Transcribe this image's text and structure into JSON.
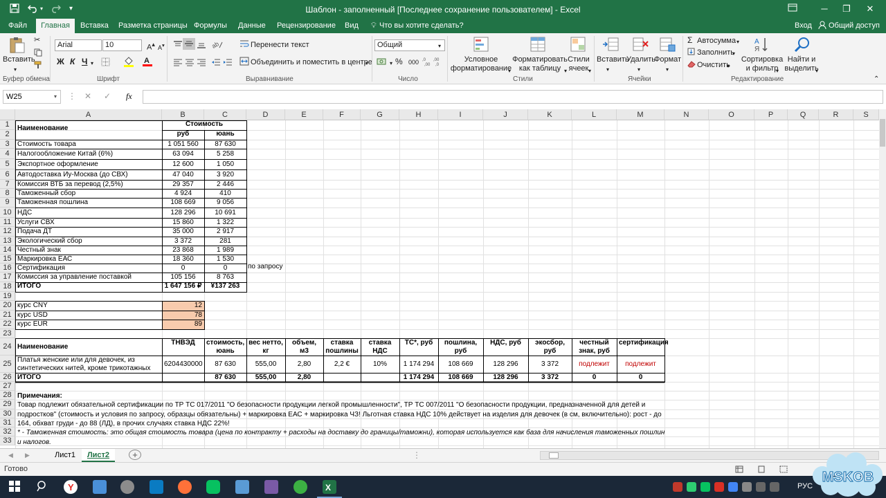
{
  "titlebar": {
    "title": "Шаблон - заполненный [Последнее сохранение пользователем] - Excel",
    "save_icon": "save-icon",
    "undo_icon": "undo-icon",
    "redo_icon": "redo-icon"
  },
  "tabs": {
    "file": "Файл",
    "home": "Главная",
    "insert": "Вставка",
    "layout": "Разметка страницы",
    "formulas": "Формулы",
    "data": "Данные",
    "review": "Рецензирование",
    "view": "Вид",
    "tell_me": "Что вы хотите сделать?",
    "signin": "Вход",
    "share": "Общий доступ"
  },
  "ribbon": {
    "clipboard": {
      "paste": "Вставить",
      "label": "Буфер обмена"
    },
    "font": {
      "name": "Arial",
      "size": "10",
      "bold": "Ж",
      "italic": "К",
      "underline": "Ч",
      "label": "Шрифт"
    },
    "alignment": {
      "wrap": "Перенести текст",
      "merge": "Объединить и поместить в центре",
      "label": "Выравнивание"
    },
    "number": {
      "format": "Общий",
      "percent": "%",
      "thousands": "000",
      "label": "Число"
    },
    "styles": {
      "conditional_1": "Условное",
      "conditional_2": "форматирование",
      "table_1": "Форматировать",
      "table_2": "как таблицу",
      "cell_1": "Стили",
      "cell_2": "ячеек",
      "label": "Стили"
    },
    "cells": {
      "insert": "Вставить",
      "delete": "Удалить",
      "format": "Формат",
      "label": "Ячейки"
    },
    "editing": {
      "autosum": "Автосумма",
      "fill": "Заполнить",
      "clear": "Очистить",
      "sort_1": "Сортировка",
      "sort_2": "и фильтр",
      "find_1": "Найти и",
      "find_2": "выделить",
      "label": "Редактирование"
    }
  },
  "formula_bar": {
    "name_box": "W25",
    "cancel": "✕",
    "enter": "✓",
    "fx": "fx",
    "content": ""
  },
  "columns": [
    "A",
    "B",
    "C",
    "D",
    "E",
    "F",
    "G",
    "H",
    "I",
    "J",
    "K",
    "L",
    "M",
    "N",
    "O",
    "P",
    "Q",
    "R",
    "S"
  ],
  "rows": [
    "1",
    "2",
    "3",
    "4",
    "5",
    "6",
    "7",
    "8",
    "9",
    "10",
    "11",
    "12",
    "13",
    "14",
    "15",
    "16",
    "17",
    "18",
    "19",
    "20",
    "21",
    "22",
    "23",
    "24",
    "25",
    "26",
    "27",
    "28",
    "29",
    "30",
    "31",
    "32",
    "33"
  ],
  "cost_table": {
    "name_header": "Наименование",
    "cost_header": "Стоимость",
    "rub_header": "руб",
    "yuan_header": "юань",
    "rows": [
      {
        "name": "Стоимость товара",
        "rub": "1 051 560",
        "yuan": "87 630"
      },
      {
        "name": "Налогообложение Китай (6%)",
        "rub": "63 094",
        "yuan": "5 258"
      },
      {
        "name": "Экспортное оформление",
        "rub": "12 600",
        "yuan": "1 050"
      },
      {
        "name": "Автодоставка Иу-Москва (до СВХ)",
        "rub": "47 040",
        "yuan": "3 920"
      },
      {
        "name": "Комиссия ВТБ за перевод (2,5%)",
        "rub": "29 357",
        "yuan": "2 446"
      },
      {
        "name": "Таможенный сбор",
        "rub": "4 924",
        "yuan": "410"
      },
      {
        "name": "Таможенная пошлина",
        "rub": "108 669",
        "yuan": "9 056"
      },
      {
        "name": "НДС",
        "rub": "128 296",
        "yuan": "10 691"
      },
      {
        "name": "Услуги СВХ",
        "rub": "15 860",
        "yuan": "1 322"
      },
      {
        "name": "Подача ДТ",
        "rub": "35 000",
        "yuan": "2 917"
      },
      {
        "name": "Экологический сбор",
        "rub": "3 372",
        "yuan": "281"
      },
      {
        "name": "Честный знак",
        "rub": "23 868",
        "yuan": "1 989"
      },
      {
        "name": "Маркировка ЕАС",
        "rub": "18 360",
        "yuan": "1 530"
      },
      {
        "name": "Сертификация",
        "rub": "0",
        "yuan": "0"
      },
      {
        "name": "Комиссия за управление поставкой",
        "rub": "105 156",
        "yuan": "8 763"
      }
    ],
    "note_d16": "по запросу",
    "total": {
      "name": "ИТОГО",
      "rub": "1 647 156 ₽",
      "yuan": "¥137 263"
    }
  },
  "rates": [
    {
      "name": "курс CNY",
      "value": "12"
    },
    {
      "name": "курс USD",
      "value": "78"
    },
    {
      "name": "курс EUR",
      "value": "89"
    }
  ],
  "product_table": {
    "headers": [
      "Наименование",
      "ТНВЭД",
      "стоимость, юань",
      "вес нетто, кг",
      "объем, м3",
      "ставка пошлины",
      "ставка НДС",
      "ТС*, руб",
      "пошлина, руб",
      "НДС, руб",
      "экосбор, руб",
      "честный знак, руб",
      "сертификация"
    ],
    "row": [
      "Платья женские или для девочек, из синтетических нитей, кроме трикотажных",
      "6204430000",
      "87 630",
      "555,00",
      "2,80",
      "2,2 €",
      "10%",
      "1 174 294",
      "108 669",
      "128 296",
      "3 372",
      "подлежит",
      "подлежит"
    ],
    "total": [
      "ИТОГО",
      "",
      "87 630",
      "555,00",
      "2,80",
      "",
      "",
      "1 174 294",
      "108 669",
      "128 296",
      "3 372",
      "0",
      "0"
    ]
  },
  "notes": {
    "title": "Примечания:",
    "line1": "Товар подлежит обязательной сертификации по  ТР ТС 017/2011 \"О безопасности продукции легкой промышленности\", ТР ТС 007/2011 \"О безопасности продукции, предназначенной для детей и",
    "line2": "подростков\" (стоимость и условия по запросу, образцы обязательны) + маркировка  ЕАС + маркировка ЧЗ! Льготная ставка НДС 10% действует на изделия для девочек (в см, включительно): рост - до",
    "line3": "164, обхват груди - до 88 (ЛД), в прочих случаях ставка НДС 22%!",
    "line4": "* - Таможенная стоимость: это общая стоимость товара (цена по контракту + расходы на доставку до границы/таможни), которая используется как база для начисления таможенных пошлин",
    "line5": "и налогов."
  },
  "sheets": {
    "sheet1": "Лист1",
    "sheet2": "Лист2",
    "add": "+"
  },
  "status": {
    "ready": "Готово"
  },
  "taskbar": {
    "lang": "РУС",
    "watermark": "MSKOB"
  },
  "colors": {
    "excel_green": "#217346",
    "rate_fill": "#f8cbad",
    "red_text": "#c00000"
  }
}
